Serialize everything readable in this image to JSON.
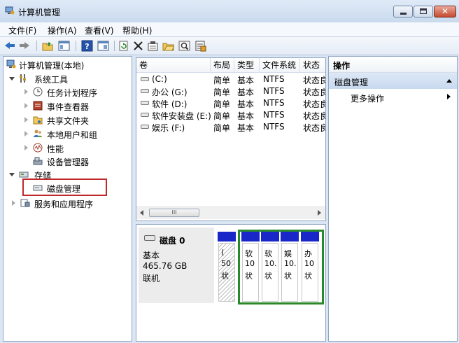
{
  "window": {
    "title": "计算机管理"
  },
  "menu": {
    "items": [
      "文件(F)",
      "操作(A)",
      "查看(V)",
      "帮助(H)"
    ]
  },
  "toolbar": {
    "icons": [
      "back-arrow-icon",
      "forward-arrow-icon",
      "folder-up-icon",
      "show-hide-tree-icon",
      "help-icon",
      "show-hide-action-icon",
      "refresh-icon",
      "delete-icon",
      "properties-icon",
      "open-icon",
      "search-icon",
      "export-icon"
    ]
  },
  "tree": {
    "root": "计算机管理(本地)",
    "system_tools": "系统工具",
    "items": [
      "任务计划程序",
      "事件查看器",
      "共享文件夹",
      "本地用户和组",
      "性能",
      "设备管理器"
    ],
    "storage": "存储",
    "disk_mgmt": "磁盘管理",
    "services": "服务和应用程序"
  },
  "volumes": {
    "headers": [
      "卷",
      "布局",
      "类型",
      "文件系统",
      "状态"
    ],
    "rows": [
      {
        "name": "(C:)",
        "layout": "简单",
        "type": "基本",
        "fs": "NTFS",
        "status": "状态良"
      },
      {
        "name": "办公 (G:)",
        "layout": "简单",
        "type": "基本",
        "fs": "NTFS",
        "status": "状态良"
      },
      {
        "name": "软件 (D:)",
        "layout": "简单",
        "type": "基本",
        "fs": "NTFS",
        "status": "状态良"
      },
      {
        "name": "软件安装盘 (E:)",
        "layout": "简单",
        "type": "基本",
        "fs": "NTFS",
        "status": "状态良"
      },
      {
        "name": "娱乐 (F:)",
        "layout": "简单",
        "type": "基本",
        "fs": "NTFS",
        "status": "状态良"
      }
    ],
    "scroll_thumb": "III"
  },
  "disk": {
    "name": "磁盘 0",
    "kind": "基本",
    "size": "465.76 GB",
    "state": "联机",
    "partitions": [
      {
        "l1": "(",
        "l2": "50",
        "l3": "状"
      },
      {
        "l1": "软",
        "l2": "10",
        "l3": "状"
      },
      {
        "l1": "软",
        "l2": "10.",
        "l3": "状"
      },
      {
        "l1": "娱",
        "l2": "10.",
        "l3": "状"
      },
      {
        "l1": "办",
        "l2": "10",
        "l3": "状"
      }
    ]
  },
  "actions": {
    "header": "操作",
    "section": "磁盘管理",
    "more": "更多操作"
  },
  "colors": {
    "partition_bar": "#1a27c8",
    "extended_border": "#2a8a2a",
    "selection_box": "#c0282c"
  }
}
